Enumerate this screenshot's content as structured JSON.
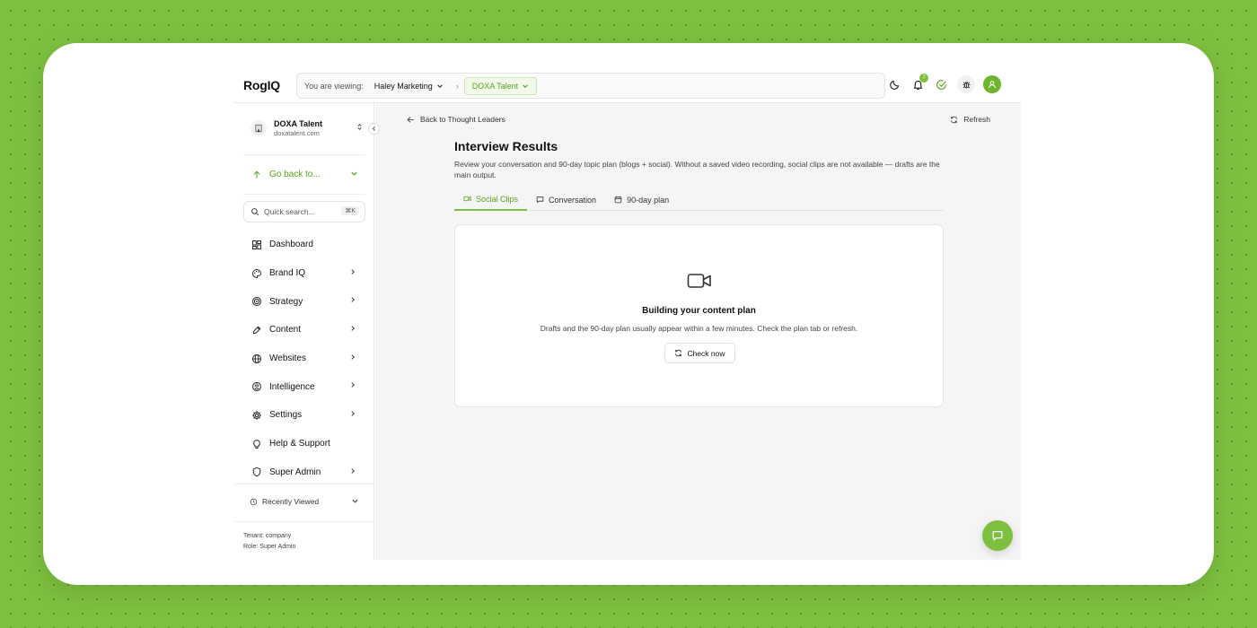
{
  "header": {
    "logo": "RogIQ",
    "viewing_label": "You are viewing:",
    "org_name": "Haley Marketing",
    "separator": "›",
    "tenant_pill": "DOXA Talent",
    "notifications_count": "7"
  },
  "sidebar": {
    "tenant_name": "DOXA Talent",
    "tenant_domain": "doxatalent.com",
    "go_back": "Go back to...",
    "search_placeholder": "Quick search...",
    "search_shortcut": "⌘K",
    "items": [
      {
        "label": "Dashboard",
        "icon": "dashboard-icon",
        "chevron": false
      },
      {
        "label": "Brand IQ",
        "icon": "palette-icon",
        "chevron": true
      },
      {
        "label": "Strategy",
        "icon": "target-icon",
        "chevron": true
      },
      {
        "label": "Content",
        "icon": "pen-icon",
        "chevron": true
      },
      {
        "label": "Websites",
        "icon": "globe-icon",
        "chevron": true
      },
      {
        "label": "Intelligence",
        "icon": "brain-icon",
        "chevron": true
      },
      {
        "label": "Settings",
        "icon": "gear-icon",
        "chevron": true
      },
      {
        "label": "Help & Support",
        "icon": "lightbulb-icon",
        "chevron": false
      },
      {
        "label": "Super Admin",
        "icon": "shield-icon",
        "chevron": true
      }
    ],
    "recently_viewed": "Recently Viewed",
    "tenant_meta": "Tenant: company",
    "role_meta": "Role: Super Admin"
  },
  "main": {
    "back_link": "Back to Thought Leaders",
    "refresh": "Refresh",
    "title": "Interview Results",
    "description": "Review your conversation and 90-day topic plan (blogs + social). Without a saved video recording, social clips are not available — drafts are the main output.",
    "tabs": [
      {
        "label": "Social Clips",
        "active": true
      },
      {
        "label": "Conversation",
        "active": false
      },
      {
        "label": "90-day plan",
        "active": false
      }
    ],
    "empty_state": {
      "title": "Building your content plan",
      "subtitle": "Drafts and the 90-day plan usually appear within a few minutes. Check the plan tab or refresh.",
      "button": "Check now"
    }
  },
  "colors": {
    "accent": "#7dc03f",
    "accent_text": "#5aa21f",
    "background": "#7dc03f"
  }
}
